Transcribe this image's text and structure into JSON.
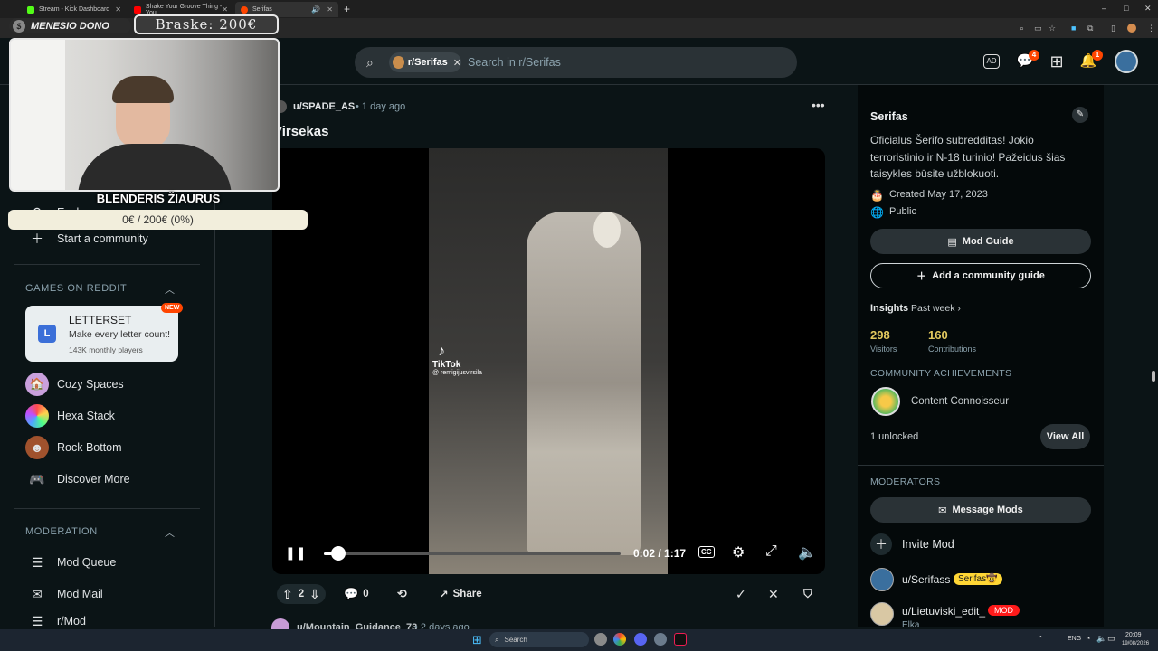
{
  "browser": {
    "tabs": [
      {
        "title": "Stream - Kick Dashboard",
        "favicon_color": "#53fc18"
      },
      {
        "title": "Shake Your Groove Thing - You",
        "favicon_color": "#ff0000"
      },
      {
        "title": "Serifas",
        "favicon_color": "#ff4500"
      }
    ],
    "new_tab": "+",
    "window_controls": {
      "minimize": "–",
      "maximize": "□",
      "close": "✕"
    }
  },
  "overlay": {
    "donate_label": "MENESIO DONO",
    "goal_label": "Braske: 200€",
    "streamer_name": "BLENDERIS ŽIAURUS",
    "goal_progress_text": "0€ / 200€ (0%)",
    "goal_progress": 0
  },
  "header": {
    "search_chip": "r/Serifas",
    "search_placeholder": "Search in r/Serifas",
    "chat_badge": "4",
    "notif_badge": "1"
  },
  "sidebar": {
    "explore": "Explore",
    "start_community": "Start a community",
    "games_section": "GAMES ON REDDIT",
    "game_card": {
      "title": "LETTERSET",
      "badge": "NEW",
      "tagline": "Make every letter count!",
      "players": "143K monthly players",
      "icon": "L"
    },
    "games": [
      "Cozy Spaces",
      "Hexa Stack",
      "Rock Bottom"
    ],
    "discover": "Discover More",
    "moderation_section": "MODERATION",
    "mod_items": [
      "Mod Queue",
      "Mod Mail",
      "r/Mod"
    ]
  },
  "post": {
    "author": "u/SPADE_AS",
    "time": "• 1 day ago",
    "title": "Virsekas",
    "watermark_app": "TikTok",
    "watermark_user": "@ remigijusvirsila",
    "time_display": "0:02 / 1:17",
    "progress": 0.026,
    "votes": "2",
    "comments": "0",
    "share": "Share",
    "next_author": "u/Mountain_Guidance_73",
    "next_time": "• 2 days ago"
  },
  "community": {
    "name": "Serifas",
    "description": "Oficialus Šerifo subredditas! Jokio terroristinio ir N-18 turinio! Pažeidus šias taisykles būsite užblokuoti.",
    "created": "Created May 17, 2023",
    "visibility": "Public",
    "mod_guide": "Mod Guide",
    "add_guide": "Add a community guide",
    "insights_label": "Insights",
    "insights_period": "Past week",
    "visitors": "298",
    "visitors_label": "Visitors",
    "contributions": "160",
    "contributions_label": "Contributions",
    "achievements_heading": "COMMUNITY ACHIEVEMENTS",
    "achievement": "Content Connoisseur",
    "unlocked": "1 unlocked",
    "view_all": "View All",
    "moderators_heading": "MODERATORS",
    "message_mods": "Message Mods",
    "invite_mod": "Invite Mod",
    "mods": [
      {
        "name": "u/Serifass",
        "flair": "Serifas🤠",
        "flair_color": "#ffd635"
      },
      {
        "name": "u/Lietuviski_edit_",
        "flair": "MOD",
        "flair_color": "#ff1a1a",
        "sub": "Elka"
      }
    ]
  },
  "taskbar": {
    "search": "Search",
    "lang": "ENG",
    "time": "20:09",
    "date": "19/08/2026"
  }
}
